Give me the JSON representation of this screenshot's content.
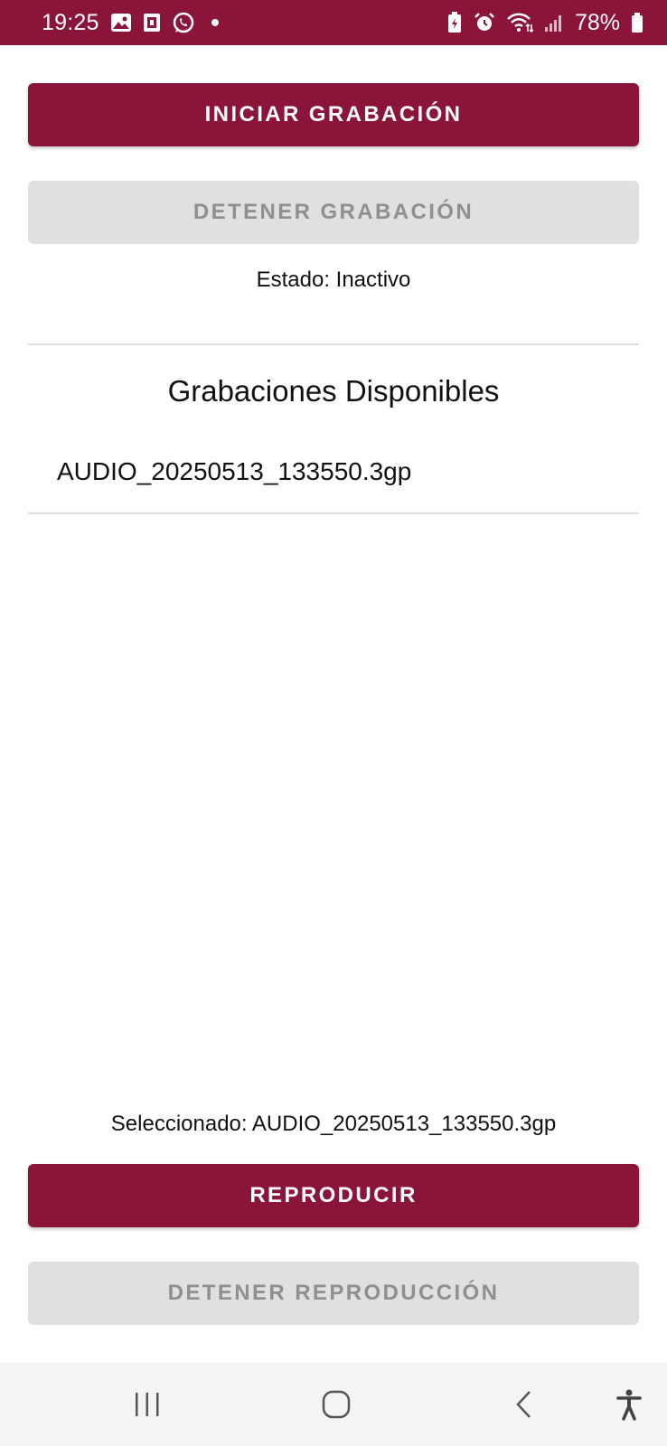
{
  "status_bar": {
    "time": "19:25",
    "battery": "78%",
    "icons_left": [
      "gallery-icon",
      "notification-app-icon",
      "whatsapp-icon",
      "more-notifications-dot"
    ],
    "icons_right": [
      "battery-saver-icon",
      "alarm-icon",
      "wifi-icon",
      "signal-icon",
      "battery-icon"
    ],
    "background_color": "#8b1538"
  },
  "recorder": {
    "start_label": "INICIAR GRABACIÓN",
    "stop_label": "DETENER GRABACIÓN",
    "status": "Estado: Inactivo"
  },
  "recordings": {
    "title": "Grabaciones Disponibles",
    "items": [
      {
        "name": "AUDIO_20250513_133550.3gp"
      }
    ]
  },
  "player": {
    "selected": "Seleccionado: AUDIO_20250513_133550.3gp",
    "play_label": "REPRODUCIR",
    "stop_label": "DETENER REPRODUCCIÓN"
  },
  "nav_bar": {
    "icons": [
      "recent-apps-icon",
      "home-icon",
      "back-icon",
      "accessibility-icon"
    ]
  },
  "colors": {
    "accent": "#8b1538",
    "disabled_bg": "#e0e0e0",
    "disabled_text": "#8f8f8f"
  }
}
